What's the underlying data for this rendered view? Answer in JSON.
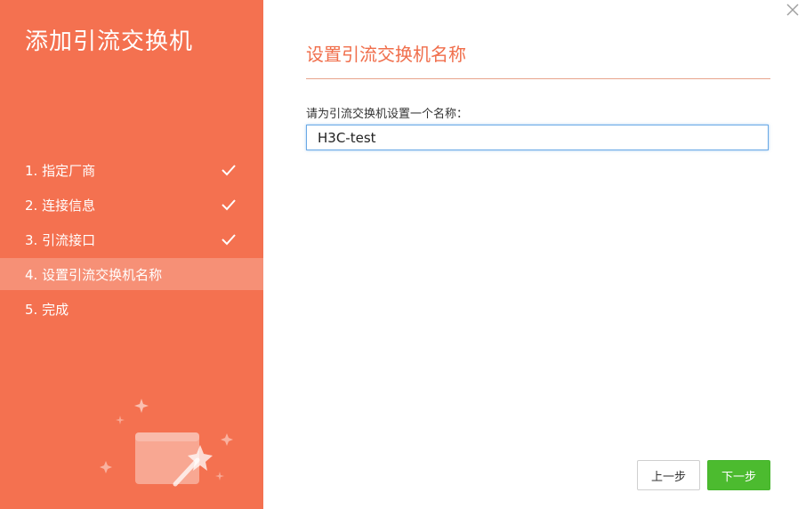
{
  "sidebar": {
    "title": "添加引流交换机",
    "steps": [
      {
        "label": "1. 指定厂商",
        "completed": true
      },
      {
        "label": "2. 连接信息",
        "completed": true
      },
      {
        "label": "3. 引流接口",
        "completed": true
      },
      {
        "label": "4. 设置引流交换机名称",
        "active": true
      },
      {
        "label": "5. 完成"
      }
    ]
  },
  "dialog": {
    "close_icon": "close-icon"
  },
  "main": {
    "section_title": "设置引流交换机名称",
    "field_label": "请为引流交换机设置一个名称：",
    "name_value": "H3C-test"
  },
  "buttons": {
    "prev": "上一步",
    "next": "下一步"
  },
  "colors": {
    "sidebar_bg": "#f47150",
    "accent_title": "#f06e4b",
    "next_button": "#4cbb2f"
  }
}
